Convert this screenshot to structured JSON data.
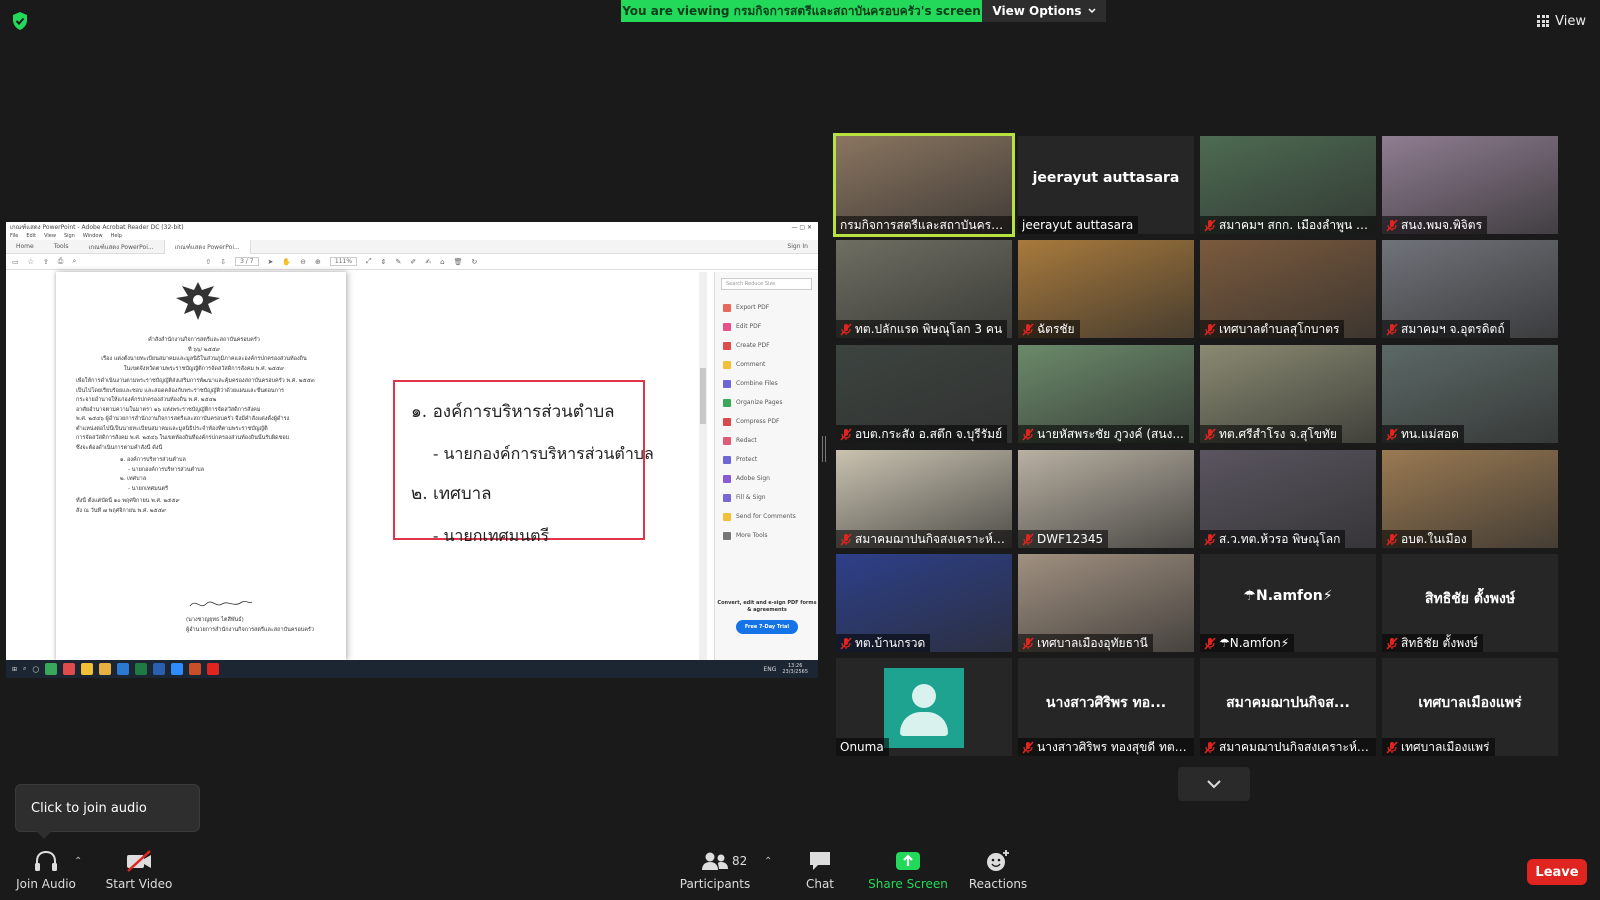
{
  "top": {
    "banner_prefix": "You are viewing ",
    "banner_name": "กรมกิจการสตรีและสถาบันครอบครัว",
    "banner_suffix": "'s screen",
    "view_options_label": "View Options",
    "view_label": "View"
  },
  "shared_screen": {
    "window_title": "เกณฑ์แสดง PowerPoint - Adobe Acrobat Reader DC (32-bit)",
    "menu": [
      "File",
      "Edit",
      "View",
      "Sign",
      "Window",
      "Help"
    ],
    "tabs": [
      "Home",
      "Tools",
      "เกณฑ์แสดง PowerPoi...",
      "เกณฑ์แสดง PowerPoi..."
    ],
    "tab_right": [
      "Sign In"
    ],
    "page_indicator": "3 / 7",
    "zoom": "111%",
    "document_lines": [
      "คำสั่งสำนักงานกิจการสตรีและสถาบันครอบครัว",
      "ที่ ๖๖/ ๒๕๕๙",
      "เรื่อง แต่งตั้งนายทะเบียนสมาคมและมูลนิธิในส่วนภูมิภาคและองค์กรปกครองส่วนท้องถิ่น",
      "ในเขตจังหวัดตามพระราชบัญญัติการจัดสวัสดิการสังคม พ.ศ. ๒๕๕๙",
      "เพื่อให้การดำเนินงานตามพระราชบัญญัติส่งเสริมการพัฒนาและคุ้มครองสถาบันครอบครัว พ.ศ. ๒๕๕๓",
      "เป็นไปโดยเรียบร้อยและชอบ และสอดคล้องกับพระราชบัญญัติว่าด้วยแผนและขั้นตอนการ",
      "กระจายอำนาจให้แก่องค์กรปกครองส่วนท้องถิ่น พ.ศ. ๒๕๔๒",
      "อาศัยอำนาจตามความในมาตรา ๑๖ แห่งพระราชบัญญัติการจัดสวัสดิการสังคม",
      "พ.ศ. ๒๕๔๖ ผู้อำนวยการสำนักงานกิจการสตรีและสถาบันครอบครัว จึงมีคำสั่งแต่งตั้งผู้ดำรง",
      "ตำแหน่งต่อไปนี้เป็นนายทะเบียนสมาคมและมูลนิธิประจำท้องที่ตามพระราชบัญญัติ",
      "การจัดสวัสดิการสังคม พ.ศ. ๒๕๔๖ ในเขตท้องถิ่นที่องค์กรปกครองส่วนท้องถิ่นนั้นรับผิดชอบ",
      "ซึ่งจะต้องดำเนินการตามคำสั่งนี้ ดังนี้",
      "๑. องค์การบริหารส่วนตำบล",
      "- นายกองค์การบริหารส่วนตำบล",
      "๒. เทศบาล",
      "- นายกเทศมนตรี",
      "ทั้งนี้ ตั้งแต่บัดนี้ ๑๐ พฤศจิกายน พ.ศ. ๒๕๕๙",
      "สั่ง ณ วันที่ ๗ พฤศจิกายน พ.ศ. ๒๕๕๙"
    ],
    "signature_name": "(นางชาญยุทธ ไตสีพันธ์)",
    "signature_title": "ผู้อำนวยการสำนักงานกิจการสตรีและสถาบันครอบครัว",
    "highlight": {
      "line1": "๑. องค์การบริหารส่วนตำบล",
      "line2": "- นายกองค์การบริหารส่วนตำบล",
      "line3": "๒. เทศบาล",
      "line4": "- นายกเทศมนตรี"
    },
    "side_search_placeholder": "Search Reduce Size",
    "side_tools": [
      {
        "label": "Export PDF",
        "color": "#e8685b"
      },
      {
        "label": "Edit PDF",
        "color": "#e8508a"
      },
      {
        "label": "Create PDF",
        "color": "#e04b4b"
      },
      {
        "label": "Comment",
        "color": "#f2c037"
      },
      {
        "label": "Combine Files",
        "color": "#6b67d6"
      },
      {
        "label": "Organize Pages",
        "color": "#3aa85a"
      },
      {
        "label": "Compress PDF",
        "color": "#d94b4b"
      },
      {
        "label": "Redact",
        "color": "#e05a7a"
      },
      {
        "label": "Protect",
        "color": "#6b67d6"
      },
      {
        "label": "Adobe Sign",
        "color": "#8a5ad6"
      },
      {
        "label": "Fill & Sign",
        "color": "#7a67d6"
      },
      {
        "label": "Send for Comments",
        "color": "#f2c037"
      },
      {
        "label": "More Tools",
        "color": "#777777"
      }
    ],
    "side_promo": "Convert, edit and e-sign PDF forms & agreements",
    "side_btn": "Free 7-Day Trial",
    "taskbar_time": "13:26",
    "taskbar_date": "23/3/2565",
    "taskbar_lang": "ENG"
  },
  "gallery": [
    {
      "name": "กรมกิจการสตรีและสถาบันครอบค...",
      "muted": false,
      "video": true,
      "active": true,
      "bg": "#8a7560"
    },
    {
      "name": "jeerayut auttasara",
      "center": "jeerayut auttasara",
      "muted": false,
      "video": false
    },
    {
      "name": "สมาคมฯ สกก. เมืองลำพูน จ.ลำ...",
      "muted": true,
      "video": true,
      "bg": "#4d6b52"
    },
    {
      "name": "สนง.พมจ.พิจิตร",
      "muted": true,
      "video": true,
      "bg": "#8f7d91"
    },
    {
      "name": "ทต.ปลักแรด พิษณุโลก 3 คน",
      "muted": true,
      "video": true,
      "bg": "#6e6e62"
    },
    {
      "name": "ฉัตรชัย",
      "muted": true,
      "video": true,
      "bg": "#a87a3c"
    },
    {
      "name": "เทศบาลตำบลสุโกบาตร",
      "muted": true,
      "video": true,
      "bg": "#7a5a3d"
    },
    {
      "name": "สมาคมฯ จ.อุตรดิตถ์",
      "muted": true,
      "video": true,
      "bg": "#70737a"
    },
    {
      "name": "อบต.กระสัง อ.สตึก จ.บุรีรัมย์",
      "muted": true,
      "video": true,
      "bg": "#3d4440"
    },
    {
      "name": "นายหัสพระชัย ภูวงค์ (สนง...",
      "muted": true,
      "video": true,
      "bg": "#6b8a6a"
    },
    {
      "name": "ทต.ศรีสำโรง จ.สุโขทัย",
      "muted": true,
      "video": true,
      "bg": "#8a8a72"
    },
    {
      "name": "ทน.แม่สอด",
      "muted": true,
      "video": true,
      "bg": "#5c6966"
    },
    {
      "name": "สมาคมฌาปนกิจสงเคราะห์ไท...",
      "muted": true,
      "video": true,
      "bg": "#c9c2b0"
    },
    {
      "name": "DWF12345",
      "muted": true,
      "video": true,
      "bg": "#b8b0a2"
    },
    {
      "name": "ส.ว.ทต.ห้วรอ พิษณุโลก",
      "muted": true,
      "video": true,
      "bg": "#5a5560"
    },
    {
      "name": "อบต.ในเมือง",
      "muted": true,
      "video": true,
      "bg": "#9a7a52"
    },
    {
      "name": "ทต.บ้านกรวด",
      "muted": true,
      "video": true,
      "bg": "#2d3f8a"
    },
    {
      "name": "เทศบาลเมืองอุทัยธานี",
      "muted": true,
      "video": true,
      "bg": "#a09080"
    },
    {
      "name": "☂N.amfon⚡",
      "center": "☂N.amfon⚡",
      "muted": true,
      "video": false
    },
    {
      "name": "สิทธิชัย ตั้งพงษ์",
      "center": "สิทธิชัย ตั้งพงษ์",
      "muted": true,
      "video": false
    },
    {
      "name": "Onuma",
      "muted": false,
      "video": false,
      "avatar": true
    },
    {
      "name": "นางสาวศิริพร ทองสุขดี ทต.บ...",
      "center": "นางสาวศิริพร ทอ...",
      "muted": true,
      "video": false
    },
    {
      "name": "สมาคมฌาปนกิจสงเคราะห์อ...",
      "center": "สมาคมฌาปนกิจส...",
      "muted": true,
      "video": false
    },
    {
      "name": "เทศบาลเมืองแพร่",
      "center": "เทศบาลเมืองแพร่",
      "muted": true,
      "video": false
    }
  ],
  "tooltip": {
    "text": "Click to join audio"
  },
  "toolbar": {
    "join_audio": "Join Audio",
    "start_video": "Start Video",
    "participants": "Participants",
    "participants_count": "82",
    "chat": "Chat",
    "share_screen": "Share Screen",
    "reactions": "Reactions",
    "leave": "Leave"
  },
  "colors": {
    "banner_green": "#23d959",
    "share_green": "#23d959",
    "leave_red": "#e0241f",
    "active_speaker": "#b8e23f",
    "mute_red": "#e0241f"
  }
}
